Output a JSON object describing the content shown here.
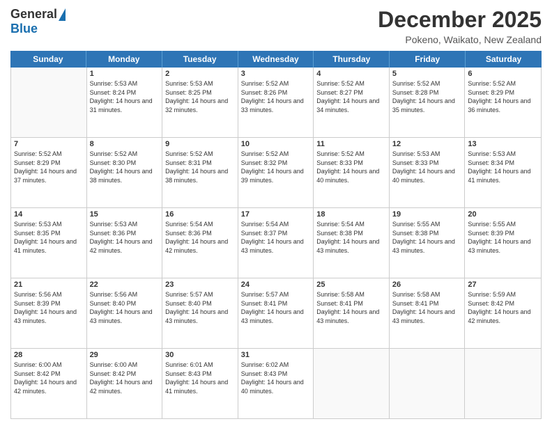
{
  "logo": {
    "general": "General",
    "blue": "Blue"
  },
  "title": "December 2025",
  "location": "Pokeno, Waikato, New Zealand",
  "days": [
    "Sunday",
    "Monday",
    "Tuesday",
    "Wednesday",
    "Thursday",
    "Friday",
    "Saturday"
  ],
  "weeks": [
    [
      {
        "day": "",
        "sunrise": "",
        "sunset": "",
        "daylight": ""
      },
      {
        "day": "1",
        "sunrise": "Sunrise: 5:53 AM",
        "sunset": "Sunset: 8:24 PM",
        "daylight": "Daylight: 14 hours and 31 minutes."
      },
      {
        "day": "2",
        "sunrise": "Sunrise: 5:53 AM",
        "sunset": "Sunset: 8:25 PM",
        "daylight": "Daylight: 14 hours and 32 minutes."
      },
      {
        "day": "3",
        "sunrise": "Sunrise: 5:52 AM",
        "sunset": "Sunset: 8:26 PM",
        "daylight": "Daylight: 14 hours and 33 minutes."
      },
      {
        "day": "4",
        "sunrise": "Sunrise: 5:52 AM",
        "sunset": "Sunset: 8:27 PM",
        "daylight": "Daylight: 14 hours and 34 minutes."
      },
      {
        "day": "5",
        "sunrise": "Sunrise: 5:52 AM",
        "sunset": "Sunset: 8:28 PM",
        "daylight": "Daylight: 14 hours and 35 minutes."
      },
      {
        "day": "6",
        "sunrise": "Sunrise: 5:52 AM",
        "sunset": "Sunset: 8:29 PM",
        "daylight": "Daylight: 14 hours and 36 minutes."
      }
    ],
    [
      {
        "day": "7",
        "sunrise": "Sunrise: 5:52 AM",
        "sunset": "Sunset: 8:29 PM",
        "daylight": "Daylight: 14 hours and 37 minutes."
      },
      {
        "day": "8",
        "sunrise": "Sunrise: 5:52 AM",
        "sunset": "Sunset: 8:30 PM",
        "daylight": "Daylight: 14 hours and 38 minutes."
      },
      {
        "day": "9",
        "sunrise": "Sunrise: 5:52 AM",
        "sunset": "Sunset: 8:31 PM",
        "daylight": "Daylight: 14 hours and 38 minutes."
      },
      {
        "day": "10",
        "sunrise": "Sunrise: 5:52 AM",
        "sunset": "Sunset: 8:32 PM",
        "daylight": "Daylight: 14 hours and 39 minutes."
      },
      {
        "day": "11",
        "sunrise": "Sunrise: 5:52 AM",
        "sunset": "Sunset: 8:33 PM",
        "daylight": "Daylight: 14 hours and 40 minutes."
      },
      {
        "day": "12",
        "sunrise": "Sunrise: 5:53 AM",
        "sunset": "Sunset: 8:33 PM",
        "daylight": "Daylight: 14 hours and 40 minutes."
      },
      {
        "day": "13",
        "sunrise": "Sunrise: 5:53 AM",
        "sunset": "Sunset: 8:34 PM",
        "daylight": "Daylight: 14 hours and 41 minutes."
      }
    ],
    [
      {
        "day": "14",
        "sunrise": "Sunrise: 5:53 AM",
        "sunset": "Sunset: 8:35 PM",
        "daylight": "Daylight: 14 hours and 41 minutes."
      },
      {
        "day": "15",
        "sunrise": "Sunrise: 5:53 AM",
        "sunset": "Sunset: 8:36 PM",
        "daylight": "Daylight: 14 hours and 42 minutes."
      },
      {
        "day": "16",
        "sunrise": "Sunrise: 5:54 AM",
        "sunset": "Sunset: 8:36 PM",
        "daylight": "Daylight: 14 hours and 42 minutes."
      },
      {
        "day": "17",
        "sunrise": "Sunrise: 5:54 AM",
        "sunset": "Sunset: 8:37 PM",
        "daylight": "Daylight: 14 hours and 43 minutes."
      },
      {
        "day": "18",
        "sunrise": "Sunrise: 5:54 AM",
        "sunset": "Sunset: 8:38 PM",
        "daylight": "Daylight: 14 hours and 43 minutes."
      },
      {
        "day": "19",
        "sunrise": "Sunrise: 5:55 AM",
        "sunset": "Sunset: 8:38 PM",
        "daylight": "Daylight: 14 hours and 43 minutes."
      },
      {
        "day": "20",
        "sunrise": "Sunrise: 5:55 AM",
        "sunset": "Sunset: 8:39 PM",
        "daylight": "Daylight: 14 hours and 43 minutes."
      }
    ],
    [
      {
        "day": "21",
        "sunrise": "Sunrise: 5:56 AM",
        "sunset": "Sunset: 8:39 PM",
        "daylight": "Daylight: 14 hours and 43 minutes."
      },
      {
        "day": "22",
        "sunrise": "Sunrise: 5:56 AM",
        "sunset": "Sunset: 8:40 PM",
        "daylight": "Daylight: 14 hours and 43 minutes."
      },
      {
        "day": "23",
        "sunrise": "Sunrise: 5:57 AM",
        "sunset": "Sunset: 8:40 PM",
        "daylight": "Daylight: 14 hours and 43 minutes."
      },
      {
        "day": "24",
        "sunrise": "Sunrise: 5:57 AM",
        "sunset": "Sunset: 8:41 PM",
        "daylight": "Daylight: 14 hours and 43 minutes."
      },
      {
        "day": "25",
        "sunrise": "Sunrise: 5:58 AM",
        "sunset": "Sunset: 8:41 PM",
        "daylight": "Daylight: 14 hours and 43 minutes."
      },
      {
        "day": "26",
        "sunrise": "Sunrise: 5:58 AM",
        "sunset": "Sunset: 8:41 PM",
        "daylight": "Daylight: 14 hours and 43 minutes."
      },
      {
        "day": "27",
        "sunrise": "Sunrise: 5:59 AM",
        "sunset": "Sunset: 8:42 PM",
        "daylight": "Daylight: 14 hours and 42 minutes."
      }
    ],
    [
      {
        "day": "28",
        "sunrise": "Sunrise: 6:00 AM",
        "sunset": "Sunset: 8:42 PM",
        "daylight": "Daylight: 14 hours and 42 minutes."
      },
      {
        "day": "29",
        "sunrise": "Sunrise: 6:00 AM",
        "sunset": "Sunset: 8:42 PM",
        "daylight": "Daylight: 14 hours and 42 minutes."
      },
      {
        "day": "30",
        "sunrise": "Sunrise: 6:01 AM",
        "sunset": "Sunset: 8:43 PM",
        "daylight": "Daylight: 14 hours and 41 minutes."
      },
      {
        "day": "31",
        "sunrise": "Sunrise: 6:02 AM",
        "sunset": "Sunset: 8:43 PM",
        "daylight": "Daylight: 14 hours and 40 minutes."
      },
      {
        "day": "",
        "sunrise": "",
        "sunset": "",
        "daylight": ""
      },
      {
        "day": "",
        "sunrise": "",
        "sunset": "",
        "daylight": ""
      },
      {
        "day": "",
        "sunrise": "",
        "sunset": "",
        "daylight": ""
      }
    ]
  ]
}
